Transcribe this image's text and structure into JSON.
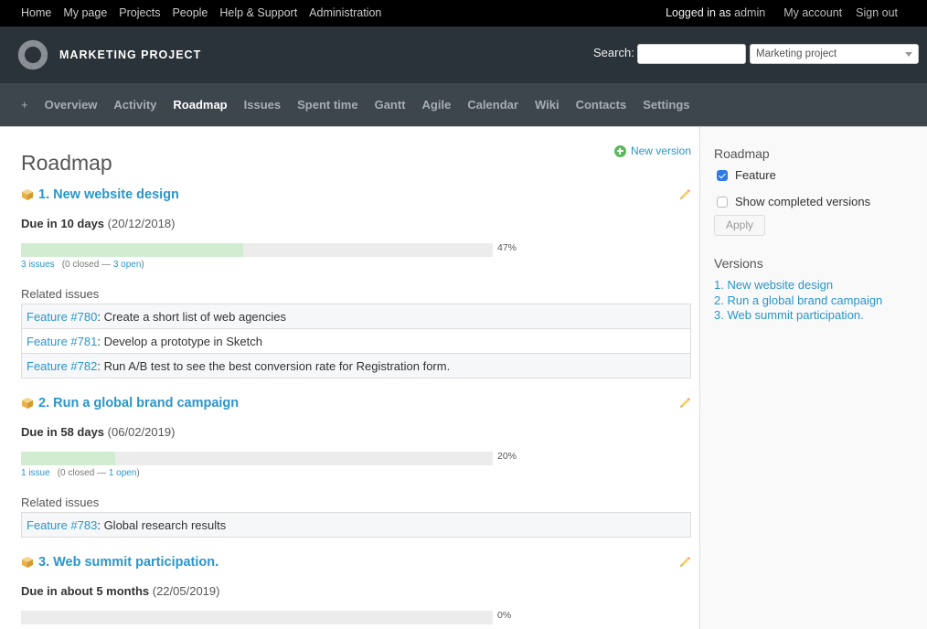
{
  "top_menu": {
    "items": [
      "Home",
      "My page",
      "Projects",
      "People",
      "Help & Support",
      "Administration"
    ],
    "logged_in_prefix": "Logged in as",
    "user": "admin",
    "my_account": "My account",
    "sign_out": "Sign out"
  },
  "header": {
    "project_title": "MARKETING PROJECT",
    "search_label": "Search:",
    "search_value": "",
    "project_select": "Marketing project"
  },
  "main_menu": {
    "plus": "+",
    "items": [
      "Overview",
      "Activity",
      "Roadmap",
      "Issues",
      "Spent time",
      "Gantt",
      "Agile",
      "Calendar",
      "Wiki",
      "Contacts",
      "Settings"
    ],
    "selected": "Roadmap"
  },
  "content": {
    "title": "Roadmap",
    "new_version": "New version",
    "related_label": "Related issues",
    "versions": [
      {
        "title": "1. New website design",
        "due_label": "Due in 10 days",
        "due_date": "(20/12/2018)",
        "progress_percent": 47,
        "percent_label": "47%",
        "issues_link": "3 issues",
        "closed_text": "(0 closed —",
        "open_link": "3 open",
        "close_paren": ")",
        "related": [
          {
            "tracker": "Feature #780",
            "subject": ": Create a short list of web agencies"
          },
          {
            "tracker": "Feature #781",
            "subject": ": Develop a prototype in Sketch"
          },
          {
            "tracker": "Feature #782",
            "subject": ": Run A/B test to see the best conversion rate for Registration form."
          }
        ]
      },
      {
        "title": "2. Run a global brand campaign",
        "due_label": "Due in 58 days",
        "due_date": "(06/02/2019)",
        "progress_percent": 20,
        "percent_label": "20%",
        "issues_link": "1 issue",
        "closed_text": "(0 closed —",
        "open_link": "1 open",
        "close_paren": ")",
        "related": [
          {
            "tracker": "Feature #783",
            "subject": ": Global research results"
          }
        ]
      },
      {
        "title": "3. Web summit participation.",
        "due_label": "Due in about 5 months",
        "due_date": "(22/05/2019)",
        "progress_percent": 0,
        "percent_label": "0%"
      }
    ]
  },
  "sidebar": {
    "roadmap_title": "Roadmap",
    "feature_label": "Feature",
    "feature_checked": true,
    "completed_label": "Show completed versions",
    "completed_checked": false,
    "apply_label": "Apply",
    "versions_title": "Versions",
    "versions": [
      "1. New website design",
      "2. Run a global brand campaign",
      "3. Web summit participation."
    ]
  },
  "colors": {
    "link": "#2996cc",
    "header_bg": "#2b333a",
    "menu_bg": "#3d454d",
    "progress_done": "#d2ecd2",
    "progress_todo": "#ececec"
  }
}
